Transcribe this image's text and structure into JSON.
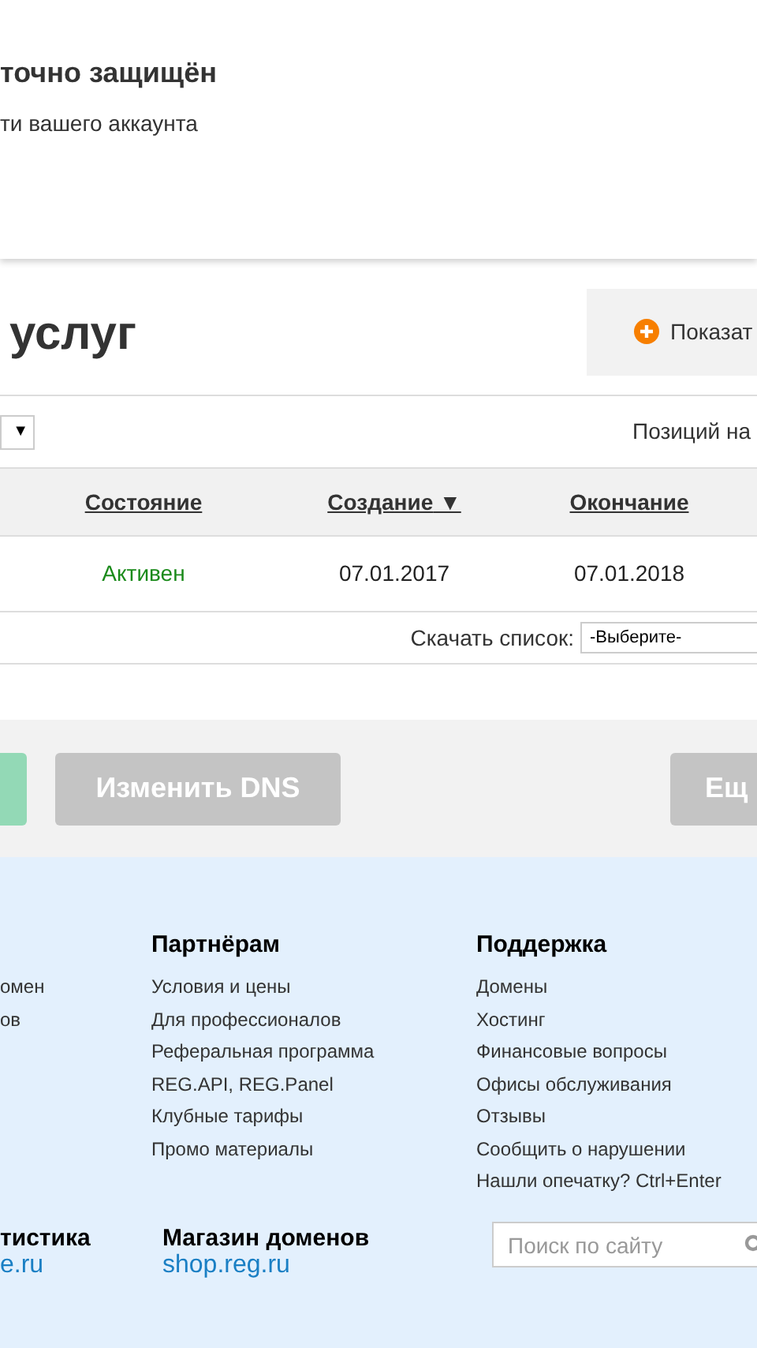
{
  "notice": {
    "title": "точно защищён",
    "text": "ти вашего аккаунта"
  },
  "services": {
    "title": "услуг",
    "show_button": "Показат"
  },
  "toolbar": {
    "select_arrow": "▼",
    "per_page_label": "Позиций на"
  },
  "table": {
    "columns": [
      {
        "label": "Состояние"
      },
      {
        "label": "Создание",
        "sort_mark": "▼"
      },
      {
        "label": "Окончание"
      }
    ],
    "rows": [
      {
        "status": "Активен",
        "created": "07.01.2017",
        "expires": "07.01.2018"
      }
    ]
  },
  "download": {
    "label": "Скачать список:",
    "value": "-Выберите-"
  },
  "actions": [
    {
      "kind": "primary",
      "disabled": true
    },
    {
      "kind": "secondary",
      "label": "Изменить DNS",
      "disabled": true
    },
    {
      "kind": "secondary",
      "label": "Ещ",
      "disabled": true
    }
  ],
  "footer": {
    "columns": [
      {
        "links": [
          "омен",
          "ов"
        ]
      },
      {
        "heading": "Партнёрам",
        "links": [
          "Условия и цены",
          "Для профессионалов",
          "Реферальная программа",
          "REG.API, REG.Panel",
          "Клубные тарифы",
          "Промо материалы"
        ]
      },
      {
        "heading": "Поддержка",
        "links": [
          "Домены",
          "Хостинг",
          "Финансовые вопросы",
          "Офисы обслуживания",
          "Отзывы",
          "Сообщить о нарушении",
          "Нашли опечатку? Ctrl+Enter"
        ]
      }
    ],
    "promos": [
      {
        "title": "тистика",
        "link": "e.ru"
      },
      {
        "title": "Магазин доменов",
        "link": "shop.reg.ru"
      }
    ],
    "search": {
      "placeholder": "Поиск по сайту"
    }
  }
}
